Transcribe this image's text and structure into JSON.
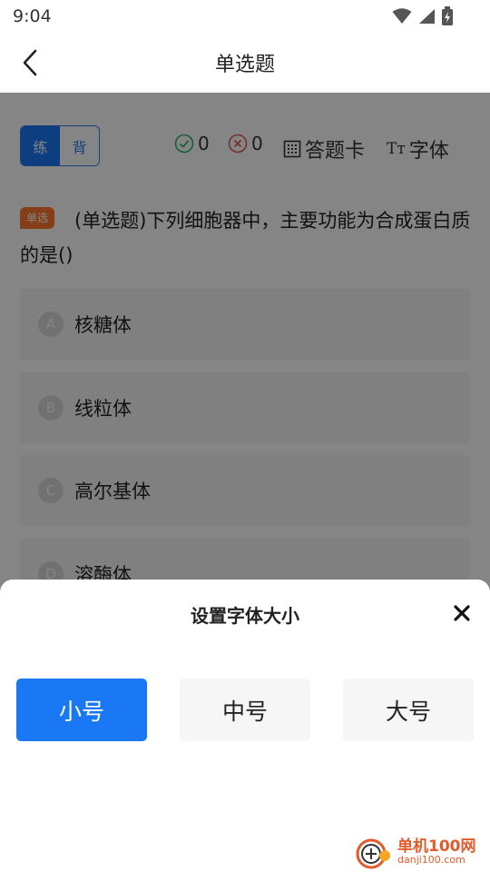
{
  "status_bar": {
    "time": "9:04"
  },
  "header": {
    "title": "单选题"
  },
  "toolbar": {
    "mode_practice": "练",
    "mode_memorize": "背",
    "correct_count": "0",
    "wrong_count": "0",
    "answer_card_label": "答题卡",
    "font_icon_text": "Tт",
    "font_label": "字体"
  },
  "question": {
    "badge": "单选",
    "text": "(单选题)下列细胞器中，主要功能为合成蛋白质的是()"
  },
  "options": [
    {
      "letter": "A",
      "text": "核糖体"
    },
    {
      "letter": "B",
      "text": "线粒体"
    },
    {
      "letter": "C",
      "text": "高尔基体"
    },
    {
      "letter": "D",
      "text": "溶酶体"
    }
  ],
  "font_sheet": {
    "title": "设置字体大小",
    "sizes": [
      "小号",
      "中号",
      "大号"
    ],
    "selected": "小号"
  },
  "watermark": {
    "name": "单机100网",
    "url": "danji100.com"
  },
  "colors": {
    "accent": "#1a78f5",
    "badge": "#ff7a2f",
    "correct": "#2bb673",
    "wrong": "#e25b4b"
  }
}
